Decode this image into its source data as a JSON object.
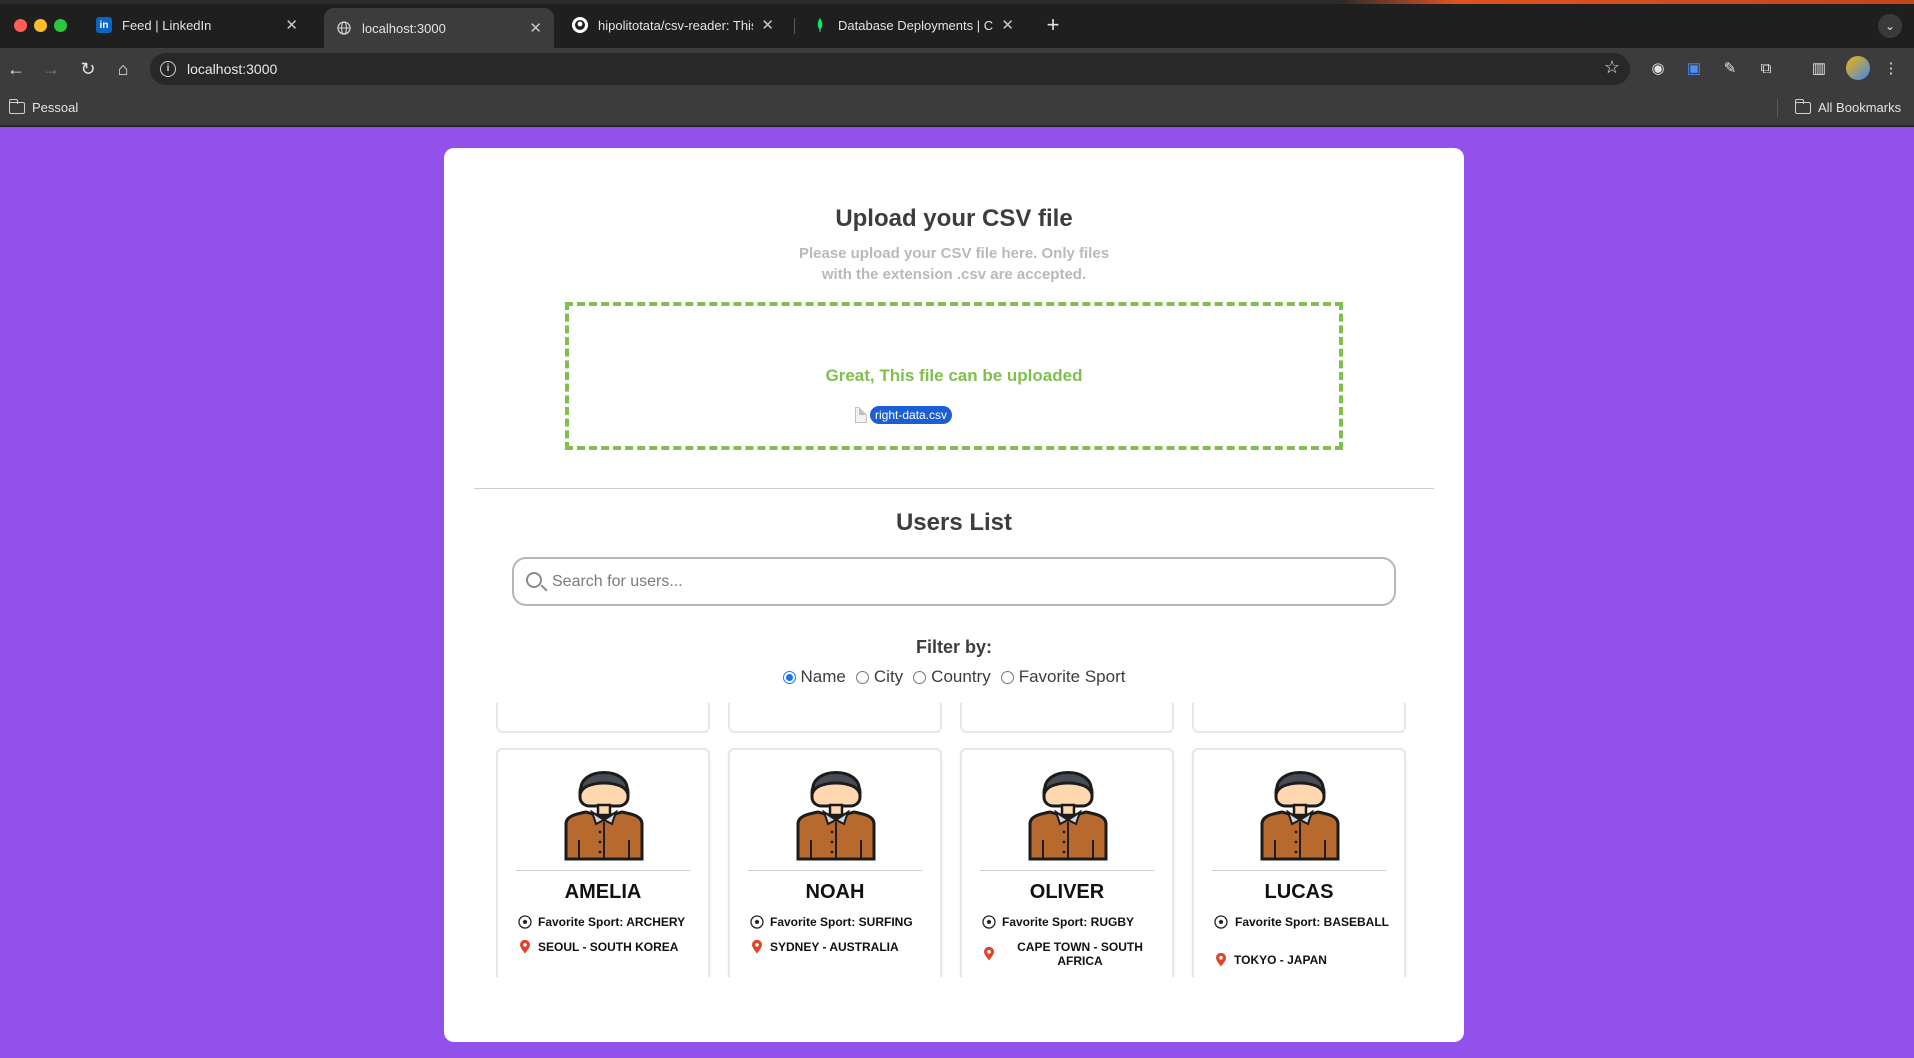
{
  "browser": {
    "tabs": [
      {
        "title": "Feed | LinkedIn",
        "icon": "linkedin-icon"
      },
      {
        "title": "localhost:3000",
        "icon": "globe-icon"
      },
      {
        "title": "hipolitotata/csv-reader: This p",
        "icon": "github-icon"
      },
      {
        "title": "Database Deployments | Clou",
        "icon": "mongodb-leaf-icon"
      }
    ],
    "url": "localhost:3000",
    "bookmarks": {
      "left_folder": "Pessoal",
      "right_folder": "All Bookmarks"
    }
  },
  "upload": {
    "title": "Upload your CSV file",
    "description": "Please upload your CSV file here. Only files with the extension .csv are accepted.",
    "status_message": "Great, This file can be uploaded",
    "file_name": "right-data.csv",
    "status_color": "#7fbf4d"
  },
  "users": {
    "title": "Users List",
    "search_placeholder": "Search for users...",
    "filter_label": "Filter by:",
    "filters": [
      {
        "label": "Name",
        "checked": true
      },
      {
        "label": "City",
        "checked": false
      },
      {
        "label": "Country",
        "checked": false
      },
      {
        "label": "Favorite Sport",
        "checked": false
      }
    ],
    "cards": [
      {
        "name": "AMELIA",
        "sport": "Favorite Sport: ARCHERY",
        "location": "SEOUL - SOUTH KOREA"
      },
      {
        "name": "NOAH",
        "sport": "Favorite Sport: SURFING",
        "location": "SYDNEY - AUSTRALIA"
      },
      {
        "name": "OLIVER",
        "sport": "Favorite Sport: RUGBY",
        "location": "CAPE TOWN - SOUTH AFRICA"
      },
      {
        "name": "LUCAS",
        "sport": "Favorite Sport: BASEBALL",
        "location": "TOKYO - JAPAN"
      }
    ]
  },
  "colors": {
    "page_background": "#9151ea",
    "accent": "#1a73e8"
  }
}
